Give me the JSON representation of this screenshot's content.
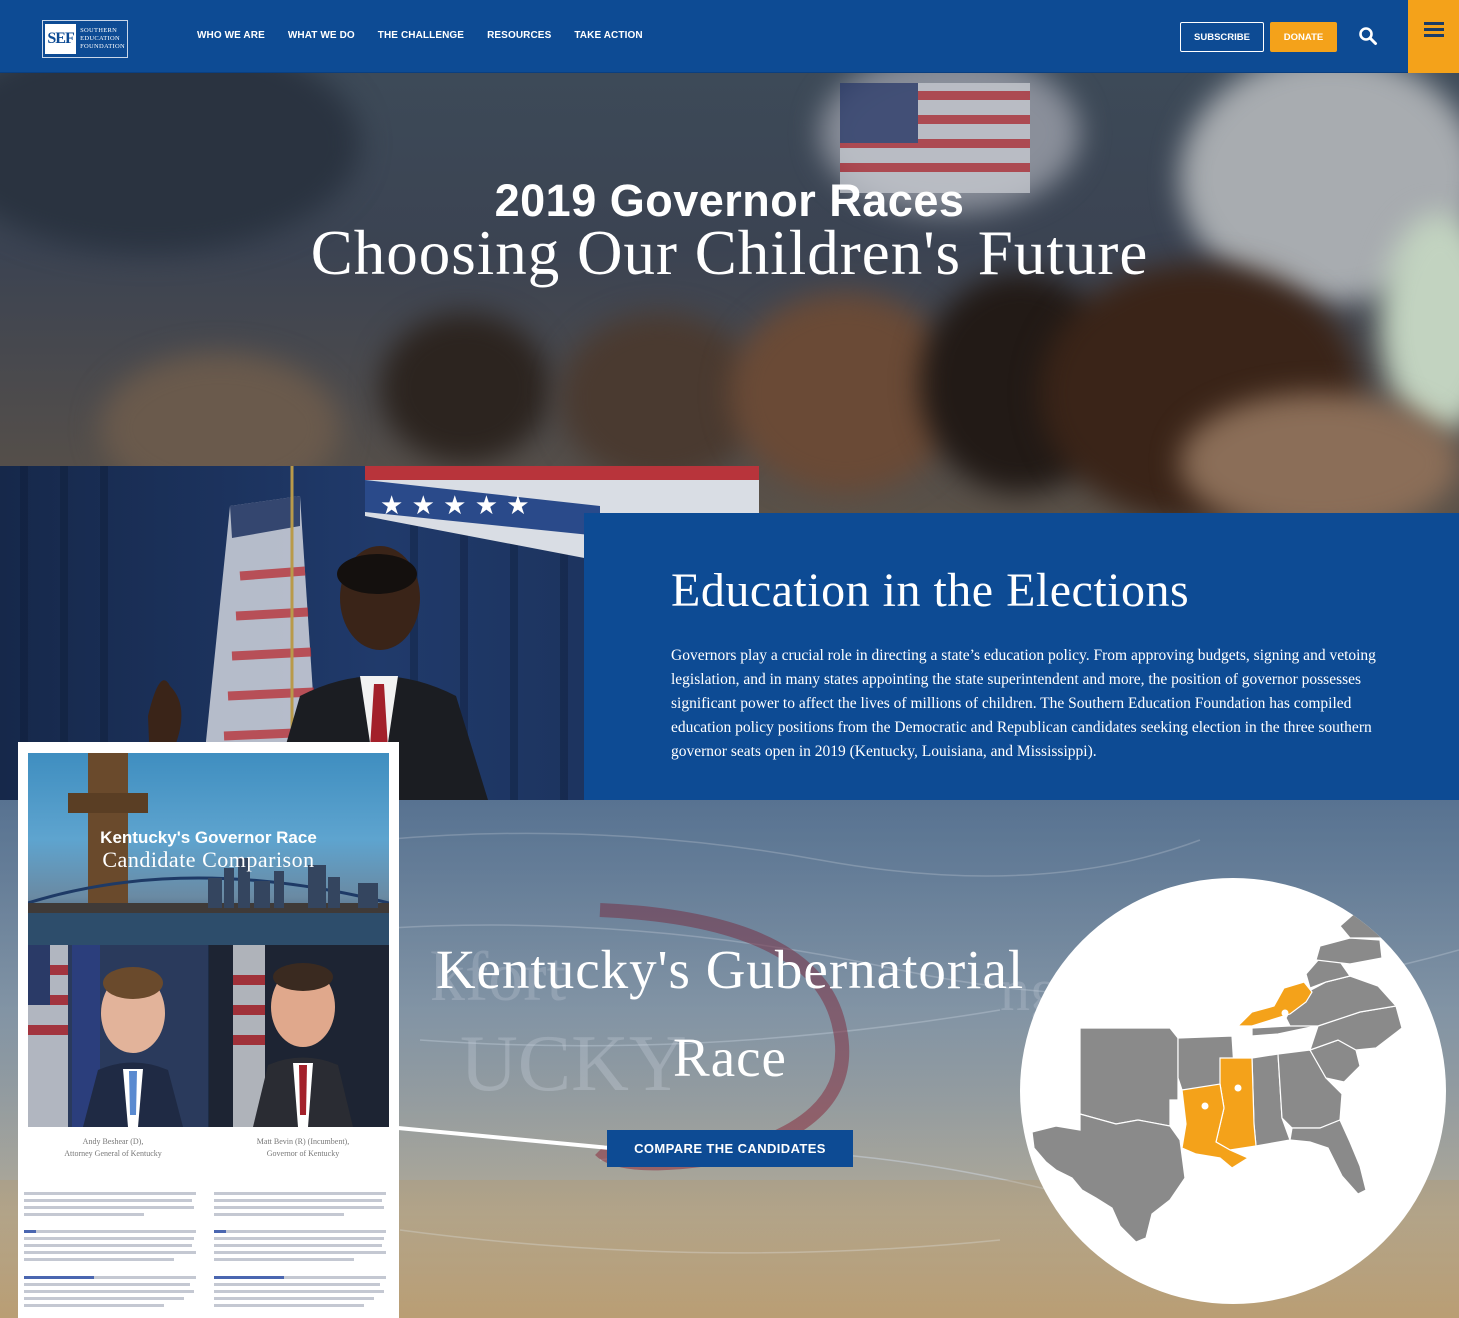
{
  "header": {
    "logo_initials": "SEF",
    "logo_text": [
      "SOUTHERN",
      "EDUCATION",
      "FOUNDATION"
    ],
    "nav": [
      "WHO WE ARE",
      "WHAT WE DO",
      "THE CHALLENGE",
      "RESOURCES",
      "TAKE ACTION"
    ],
    "subscribe_label": "SUBSCRIBE",
    "donate_label": "DONATE",
    "search_icon": "search-icon",
    "menu_icon": "hamburger-menu-icon"
  },
  "hero": {
    "title": "2019 Governor Races",
    "subtitle": "Choosing Our Children's Future"
  },
  "education": {
    "heading": "Education in the Elections",
    "body": "Governors play a crucial role in directing a state’s education policy. From approving budgets, signing and vetoing legislation, and in many states appointing the state superintendent and more, the position of governor possesses significant power to affect the lives of millions of children. The Southern Education Foundation has compiled education policy positions from the Democratic and Republican candidates seeking election in the three southern governor seats open in 2019 (Kentucky, Louisiana, and Mississippi)."
  },
  "kentucky": {
    "title_line1": "Kentucky's Gubernatorial",
    "title_line2": "Race",
    "cta": "COMPARE THE CANDIDATES"
  },
  "report": {
    "cover_title": "Kentucky's Governor Race",
    "cover_subtitle": "Candidate Comparison",
    "candidate1_name": "Andy Beshear (D),",
    "candidate1_role": "Attorney General of Kentucky",
    "candidate2_name": "Matt Bevin (R) (Incumbent),",
    "candidate2_role": "Governor of Kentucky"
  },
  "colors": {
    "brand_blue": "#0d4b94",
    "accent_orange": "#f4a21a",
    "state_gray": "#8a8a8a",
    "highlight_state": "#f4a21a"
  }
}
